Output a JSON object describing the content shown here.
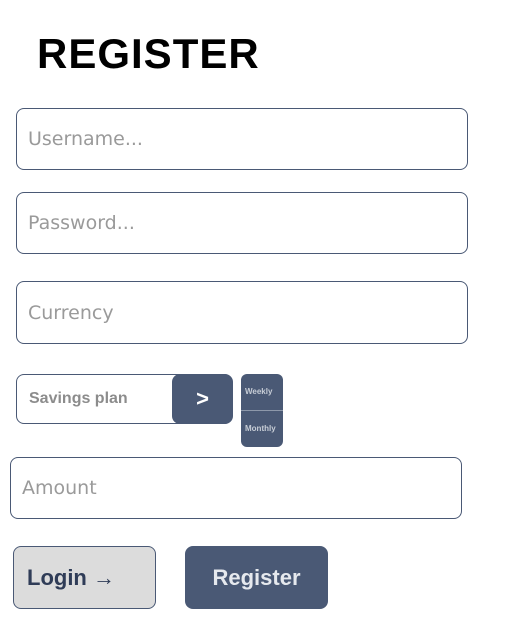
{
  "header": {
    "title": "REGISTER"
  },
  "form": {
    "username": {
      "placeholder": "Username..."
    },
    "password": {
      "placeholder": "Password..."
    },
    "currency": {
      "placeholder": "Currency"
    },
    "savings_plan": {
      "label": "Savings plan",
      "next_label": ">",
      "options": [
        "Weekly",
        "Monthly"
      ]
    },
    "amount": {
      "placeholder": "Amount"
    }
  },
  "actions": {
    "login_label": "Login →",
    "register_label": "Register"
  },
  "colors": {
    "accent": "#4a5975",
    "login_bg": "#dcdcdc",
    "placeholder": "#9a9a9a"
  }
}
